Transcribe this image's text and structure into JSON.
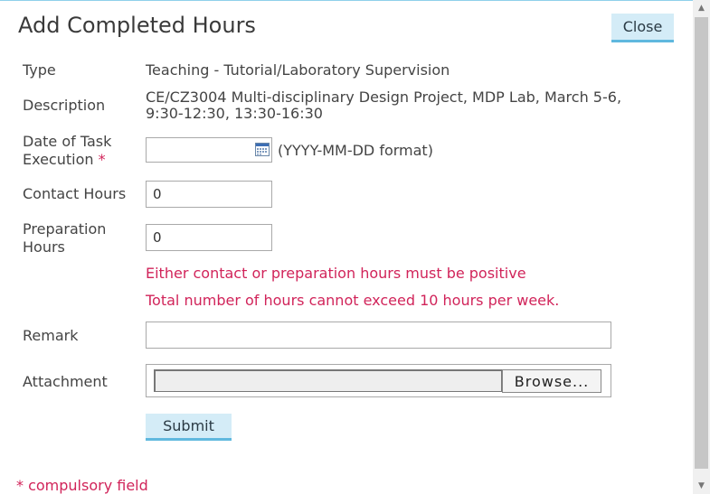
{
  "dialog": {
    "title": "Add Completed Hours",
    "close_label": "Close"
  },
  "form": {
    "type_label": "Type",
    "type_value": "Teaching - Tutorial/Laboratory Supervision",
    "description_label": "Description",
    "description_line1": "CE/CZ3004 Multi-disciplinary Design Project, MDP Lab, March 5-6,",
    "description_line2": "9:30-12:30, 13:30-16:30",
    "date_label_line1": "Date of Task",
    "date_label_line2": "Execution",
    "required_marker": "*",
    "date_value": "",
    "date_hint": "(YYYY-MM-DD format)",
    "contact_label": "Contact Hours",
    "contact_value": "0",
    "prep_label_line1": "Preparation",
    "prep_label_line2": "Hours",
    "prep_value": "0",
    "error_positive": "Either contact or preparation hours must be positive",
    "error_max": "Total number of hours cannot exceed 10 hours per week.",
    "remark_label": "Remark",
    "remark_value": "",
    "attachment_label": "Attachment",
    "browse_label": "Browse...",
    "submit_label": "Submit",
    "compulsory_note": "* compulsory field"
  },
  "icons": {
    "calendar": "calendar-icon",
    "scroll_up": "arrow-up-icon",
    "scroll_down": "arrow-down-icon"
  },
  "colors": {
    "accent": "#5fb8de",
    "button_bg": "#d4ecf7",
    "error": "#d1245a"
  }
}
